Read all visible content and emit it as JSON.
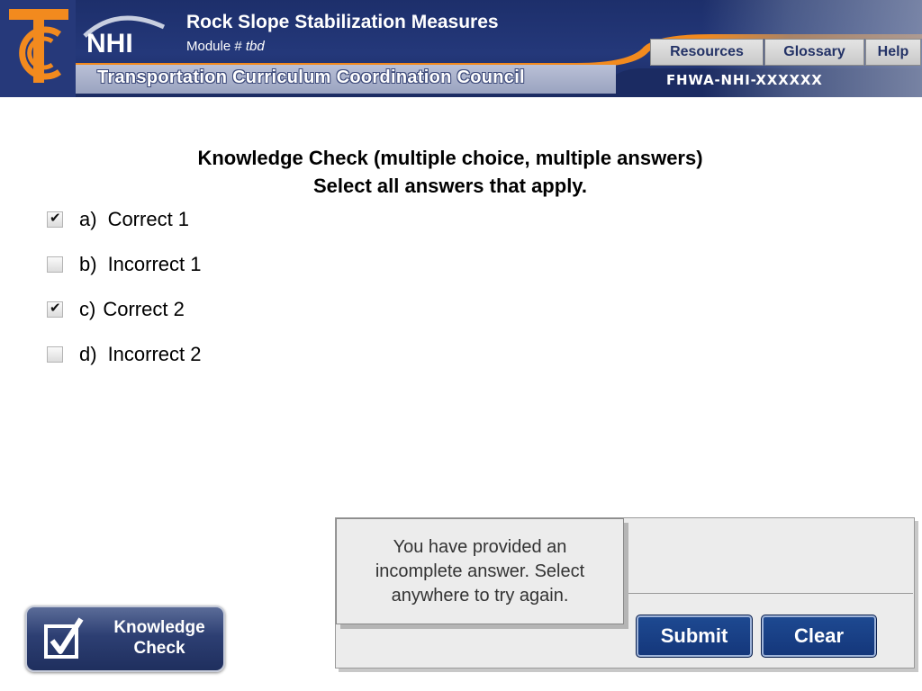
{
  "header": {
    "title": "Rock Slope Stabilization Measures",
    "module_prefix": "Module # ",
    "module_value": "tbd",
    "council": "Transportation Curriculum Coordination Council",
    "nhi_logo_text": "NHI",
    "code": "FHWA-NHI-XXXXXX",
    "nav": {
      "resources": "Resources",
      "glossary": "Glossary",
      "help": "Help"
    }
  },
  "question": {
    "title_line1": "Knowledge Check (multiple choice, multiple answers)",
    "title_line2": "Select all answers that apply.",
    "options": [
      {
        "letter": "a)",
        "label": "Correct 1",
        "checked": true
      },
      {
        "letter": "b)",
        "label": "Incorrect 1",
        "checked": false
      },
      {
        "letter": "c)",
        "label": "Correct 2",
        "checked": true
      },
      {
        "letter": "d)",
        "label": "Incorrect 2",
        "checked": false
      }
    ]
  },
  "feedback": {
    "message": "You have provided an incomplete answer. Select anywhere to try again."
  },
  "actions": {
    "submit": "Submit",
    "clear": "Clear"
  },
  "badge": {
    "line1": "Knowledge",
    "line2": "Check"
  },
  "colors": {
    "header_navy": "#24387a",
    "accent_orange": "#f28a1e",
    "button_blue": "#1a3f86"
  }
}
